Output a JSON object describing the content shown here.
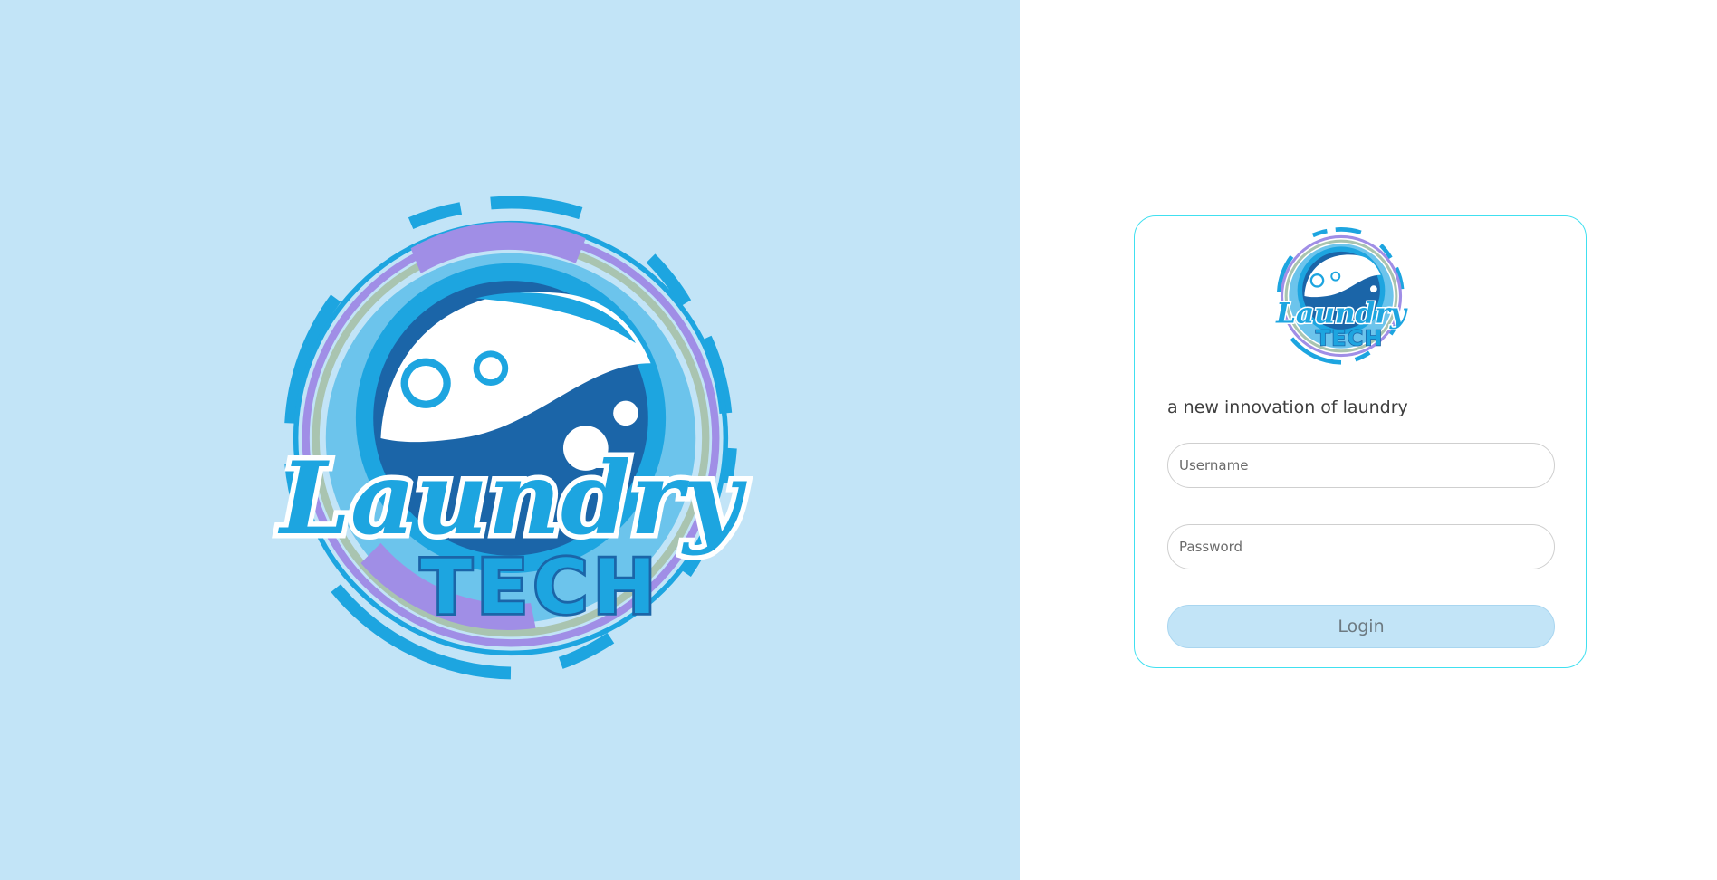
{
  "brand": {
    "logo_alt": "Laundry TECH",
    "logo_word": "Laundry",
    "logo_word2": "TECH",
    "colors": {
      "background_left": "#c2e4f7",
      "primary_blue": "#1da5e0",
      "dark_blue": "#1b65a8",
      "purple": "#a08ee6",
      "sage": "#a9c4b0",
      "card_border": "#40e0f0"
    }
  },
  "login": {
    "tagline": "a new innovation of laundry",
    "username_placeholder": "Username",
    "password_placeholder": "Password",
    "button_label": "Login"
  },
  "icons": {
    "logo": "laundry-tech-logo"
  }
}
